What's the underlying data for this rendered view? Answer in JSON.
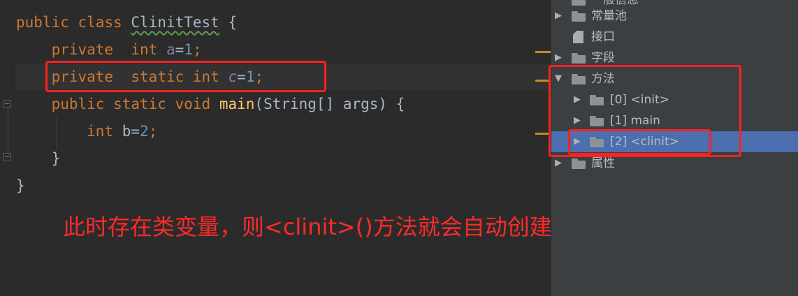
{
  "code": {
    "line1": {
      "kw1": "public",
      "kw2": "class",
      "cls": "ClinitTest",
      "brace": "{"
    },
    "line2": {
      "kw1": "private",
      "kw2": "int",
      "var": "a",
      "eq": "=",
      "num": "1",
      "semi": ";"
    },
    "line3": {
      "kw1": "private",
      "kw2": "static",
      "kw3": "int",
      "var": "c",
      "eq": "=",
      "num": "1",
      "semi": ";"
    },
    "line4": {
      "kw1": "public",
      "kw2": "static",
      "kw3": "void",
      "fn": "main",
      "params": "(String[] args) {"
    },
    "line5": {
      "kw1": "int",
      "var": "b",
      "eq": "=",
      "num": "2",
      "semi": ";"
    },
    "line6": {
      "brace": "}"
    },
    "line7": {
      "brace": "}"
    }
  },
  "annotation": "此时存在类变量，则<clinit>()方法就会自动创建",
  "tree": {
    "partial_top": "一般信息",
    "items": [
      {
        "label": "常量池"
      },
      {
        "label": "接口"
      },
      {
        "label": "字段"
      },
      {
        "label": "方法"
      },
      {
        "label": "[0] <init>"
      },
      {
        "label": "[1] main"
      },
      {
        "label": "[2] <clinit>"
      },
      {
        "label": "属性"
      }
    ]
  },
  "colors": {
    "keyword": "#cc7832",
    "number": "#6897bb",
    "field": "#9876aa",
    "function": "#ffc66d",
    "highlight_box": "#ff2020",
    "selection": "#4b6eaf"
  }
}
